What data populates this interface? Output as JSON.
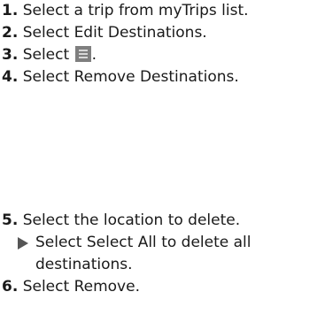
{
  "steps": [
    {
      "num": "1.",
      "parts": [
        "Select a trip from myTrips list."
      ]
    },
    {
      "num": "2.",
      "prefix": "Select ",
      "emph": "Edit Destinations",
      "suffix": "."
    },
    {
      "num": "3.",
      "prefix": "Select ",
      "icon": "menu-icon",
      "suffix": "."
    },
    {
      "num": "4.",
      "prefix": "Select ",
      "emph": "Remove Destinations",
      "suffix": "."
    },
    {
      "num": "5.",
      "text": "Select the location to delete."
    },
    {
      "num": "6.",
      "prefix": "Select ",
      "emph": "Remove",
      "suffix": "."
    }
  ],
  "substep": {
    "prefix": "Select ",
    "emph": "Select All",
    "suffix": " to delete all destinations."
  },
  "colors": {
    "text": "#1a1a1a",
    "icon_bg": "#7f7f7f",
    "triangle": "#555555"
  }
}
